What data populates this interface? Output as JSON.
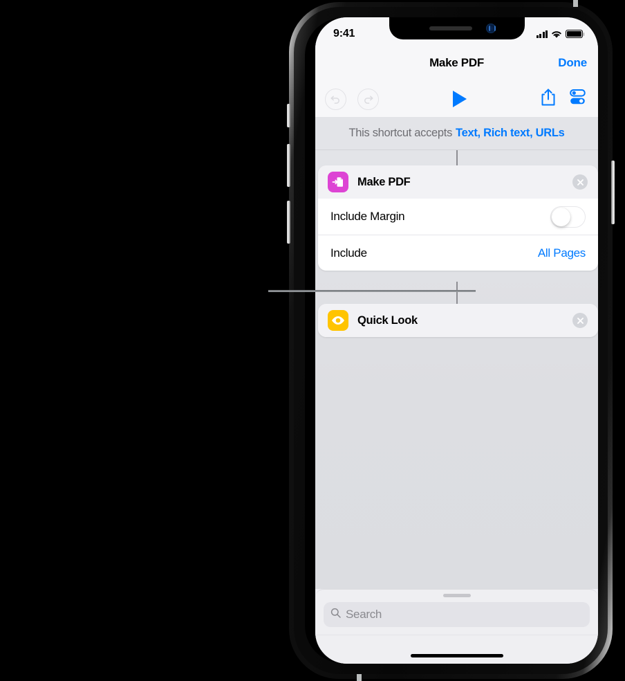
{
  "status_bar": {
    "time": "9:41",
    "signal_icon": "cellular-signal-icon",
    "wifi_icon": "wifi-icon",
    "battery_icon": "battery-full-icon"
  },
  "nav_bar": {
    "title": "Make PDF",
    "done_label": "Done"
  },
  "toolbar": {
    "undo_icon": "undo-icon",
    "redo_icon": "redo-icon",
    "play_icon": "play-icon",
    "share_icon": "share-icon",
    "settings_icon": "settings-sliders-icon"
  },
  "accepts_bar": {
    "prefix": "This shortcut accepts",
    "types": "Text, Rich text, URLs"
  },
  "actions": [
    {
      "title": "Make PDF",
      "icon": "make-pdf-icon",
      "icon_color": "#dd44d4",
      "close_icon": "close-circle-icon",
      "parameters": [
        {
          "label": "Include Margin",
          "control": "toggle",
          "value": "off"
        },
        {
          "label": "Include",
          "control": "value",
          "value": "All Pages"
        }
      ]
    },
    {
      "title": "Quick Look",
      "icon": "quick-look-eye-icon",
      "icon_color": "#ffc400",
      "close_icon": "close-circle-icon",
      "parameters": []
    }
  ],
  "search": {
    "placeholder": "Search",
    "icon": "search-icon"
  },
  "home_indicator": "home-indicator",
  "colors": {
    "accent": "#007aff",
    "screen_bg": "#e3e4e8",
    "card_bg": "#f2f2f5",
    "param_bg": "#ffffff"
  }
}
